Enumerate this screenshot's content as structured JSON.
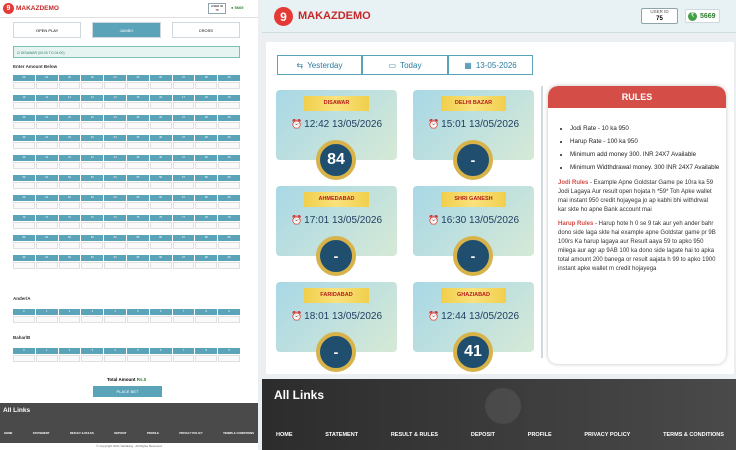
{
  "brand": {
    "logo_char": "9",
    "name": "MAKAZDEMO"
  },
  "user": {
    "id_label": "USER ID",
    "id_value": "75",
    "wallet_icon": "rupee-icon",
    "wallet": "5669"
  },
  "mobile": {
    "tabs": [
      "OPEN PLAY",
      "JAMBO",
      "CROSS"
    ],
    "market_label": "DISAWAR (00:00 TO 04:00)",
    "enter_label": "Enter Amount Below",
    "jodi_rows": [
      [
        "00",
        "01",
        "02",
        "03",
        "04",
        "05",
        "06",
        "07",
        "08",
        "09"
      ],
      [
        "10",
        "11",
        "12",
        "13",
        "14",
        "15",
        "16",
        "17",
        "18",
        "19"
      ],
      [
        "20",
        "21",
        "22",
        "23",
        "24",
        "25",
        "26",
        "27",
        "28",
        "29"
      ],
      [
        "30",
        "31",
        "32",
        "33",
        "34",
        "35",
        "36",
        "37",
        "38",
        "39"
      ],
      [
        "40",
        "41",
        "42",
        "43",
        "44",
        "45",
        "46",
        "47",
        "48",
        "49"
      ],
      [
        "50",
        "51",
        "52",
        "53",
        "54",
        "55",
        "56",
        "57",
        "58",
        "59"
      ],
      [
        "60",
        "61",
        "62",
        "63",
        "64",
        "65",
        "66",
        "67",
        "68",
        "69"
      ],
      [
        "70",
        "71",
        "72",
        "73",
        "74",
        "75",
        "76",
        "77",
        "78",
        "79"
      ],
      [
        "80",
        "81",
        "82",
        "83",
        "84",
        "85",
        "86",
        "87",
        "88",
        "89"
      ],
      [
        "90",
        "91",
        "92",
        "93",
        "94",
        "95",
        "96",
        "97",
        "98",
        "99"
      ]
    ],
    "andar_label": "Ander/A",
    "bahar_label": "Bahar/B",
    "digits": [
      "0",
      "1",
      "2",
      "3",
      "4",
      "5",
      "6",
      "7",
      "8",
      "9"
    ],
    "total_label": "Total Amount",
    "total_value": "Rs.0",
    "place_bet": "PLACE BET",
    "links_title": "All Links",
    "nav": [
      "HOME",
      "STATEMENT",
      "RESULT & RULES",
      "DEPOSIT",
      "PROFILE",
      "PRIVACY POLICY",
      "TERMS & CONDITIONS"
    ],
    "copyright": "© Copyright 2021 Sattaking . All Rights Reserved"
  },
  "dates": [
    {
      "label": "Yesterday",
      "icon": "calendar-back-icon"
    },
    {
      "label": "Today",
      "icon": "calendar-icon"
    },
    {
      "label": "13-05-2026",
      "icon": "calendar-grid-icon"
    }
  ],
  "markets": [
    {
      "name": "DISAWAR",
      "time": "12:42 13/05/2026",
      "result": "84"
    },
    {
      "name": "DELHI BAZAR",
      "time": "15:01 13/05/2026",
      "result": "-"
    },
    {
      "name": "AHMEDABAD",
      "time": "17:01 13/05/2026",
      "result": "-"
    },
    {
      "name": "SHRI GANESH",
      "time": "16:30 13/05/2026",
      "result": "-"
    },
    {
      "name": "FARIDABAD",
      "time": "18:01 13/05/2026",
      "result": "-"
    },
    {
      "name": "GHAZIABAD",
      "time": "12:44 13/05/2026",
      "result": "41"
    }
  ],
  "rules": {
    "title": "RULES",
    "items": [
      "Jodi Rate - 10 ka 950",
      "Harup Rate - 100 ka 950",
      "Minimum add money 300. INR 24X7 Available",
      "Minimum Widthdrawal money. 300 INR 24X7 Available"
    ],
    "jodi_head": "Jodi Rules",
    "jodi_text": " - Example Apne Goldstar Game pe 10ra ka 59 Jodi Lagaya Aur result open hojata h *59* Toh Apke wallet mai instant 950 credit hojayega jo ap kabhi bhi withdrwal kar skte ho apne Bank account mai",
    "harup_head": "Harup Rules",
    "harup_text": " - Harup hote h 0 se 9 tak aur yeh ander bahr dono side laga skte hai example apne Goldstar game pr 9B 100rs Ka harup lagaya aur Result aaya 59 to apko 950 milega aur agr ap 9AB 100 ka dono side lagate hai to apka total amount 200 banega or result aajata h 99 to apko 1900 instant apke wallet m credit hojayega"
  },
  "footer": {
    "title": "All Links",
    "nav": [
      "HOME",
      "STATEMENT",
      "RESULT & RULES",
      "DEPOSIT",
      "PROFILE",
      "PRIVACY POLICY",
      "TERMS & CONDITIONS"
    ]
  }
}
